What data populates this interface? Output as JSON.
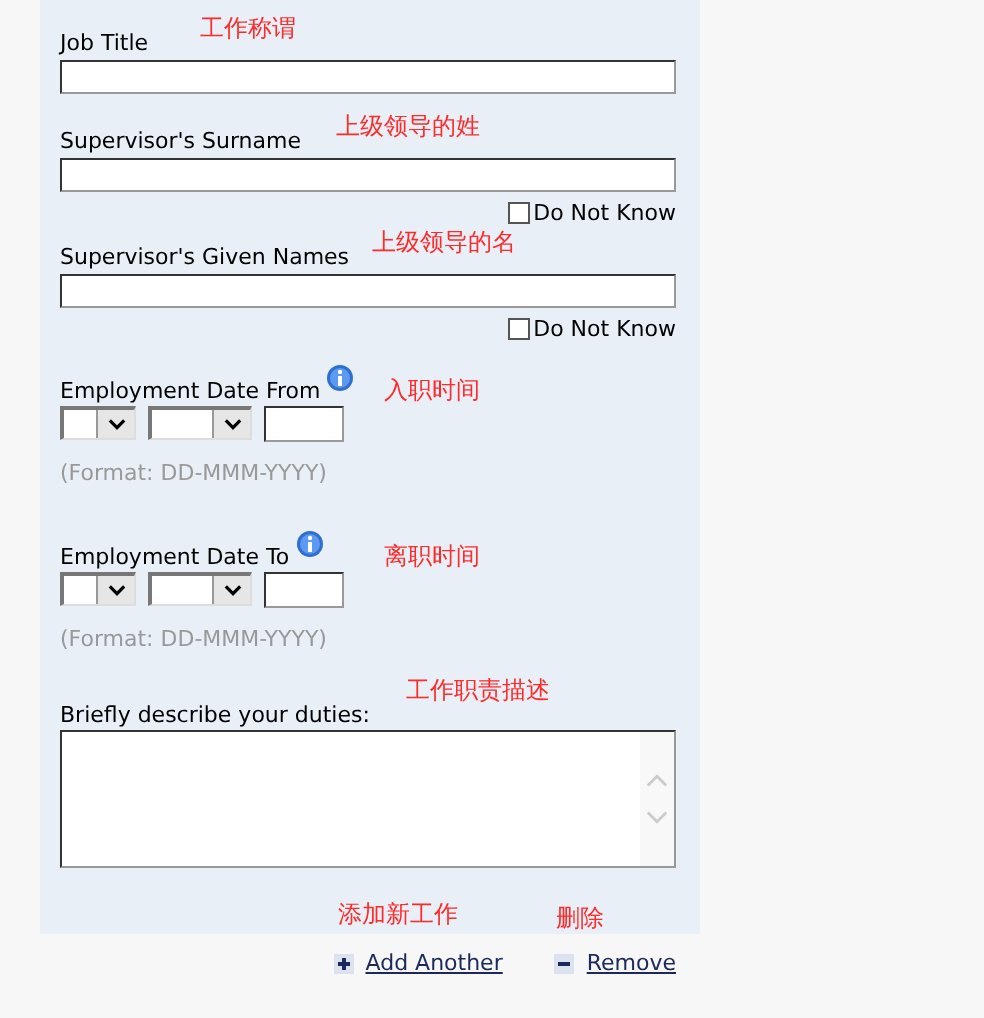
{
  "fields": [
    {
      "kind": "text",
      "label": "Job Title",
      "note": "工作称谓"
    },
    {
      "kind": "text",
      "label": "Supervisor's Surname",
      "note": "上级领导的姓",
      "unknown": {
        "label": "Do Not Know",
        "checked": false
      }
    },
    {
      "kind": "text",
      "label": "Supervisor's Given Names",
      "note": "上级领导的名",
      "unknown": {
        "label": "Do Not Know",
        "checked": false
      }
    },
    {
      "kind": "date",
      "label": "Employment Date From",
      "note": "入职时间",
      "format": "(Format: DD-MMM-YYYY)"
    },
    {
      "kind": "date",
      "label": "Employment Date To",
      "note": "离职时间",
      "format": "(Format: DD-MMM-YYYY)"
    },
    {
      "kind": "textarea",
      "label": "Briefly describe your duties:",
      "note": "工作职责描述"
    }
  ],
  "actions": [
    {
      "kind": "add",
      "label": "Add Another",
      "note": "添加新工作"
    },
    {
      "kind": "remove",
      "label": "Remove",
      "note": "删除"
    }
  ]
}
